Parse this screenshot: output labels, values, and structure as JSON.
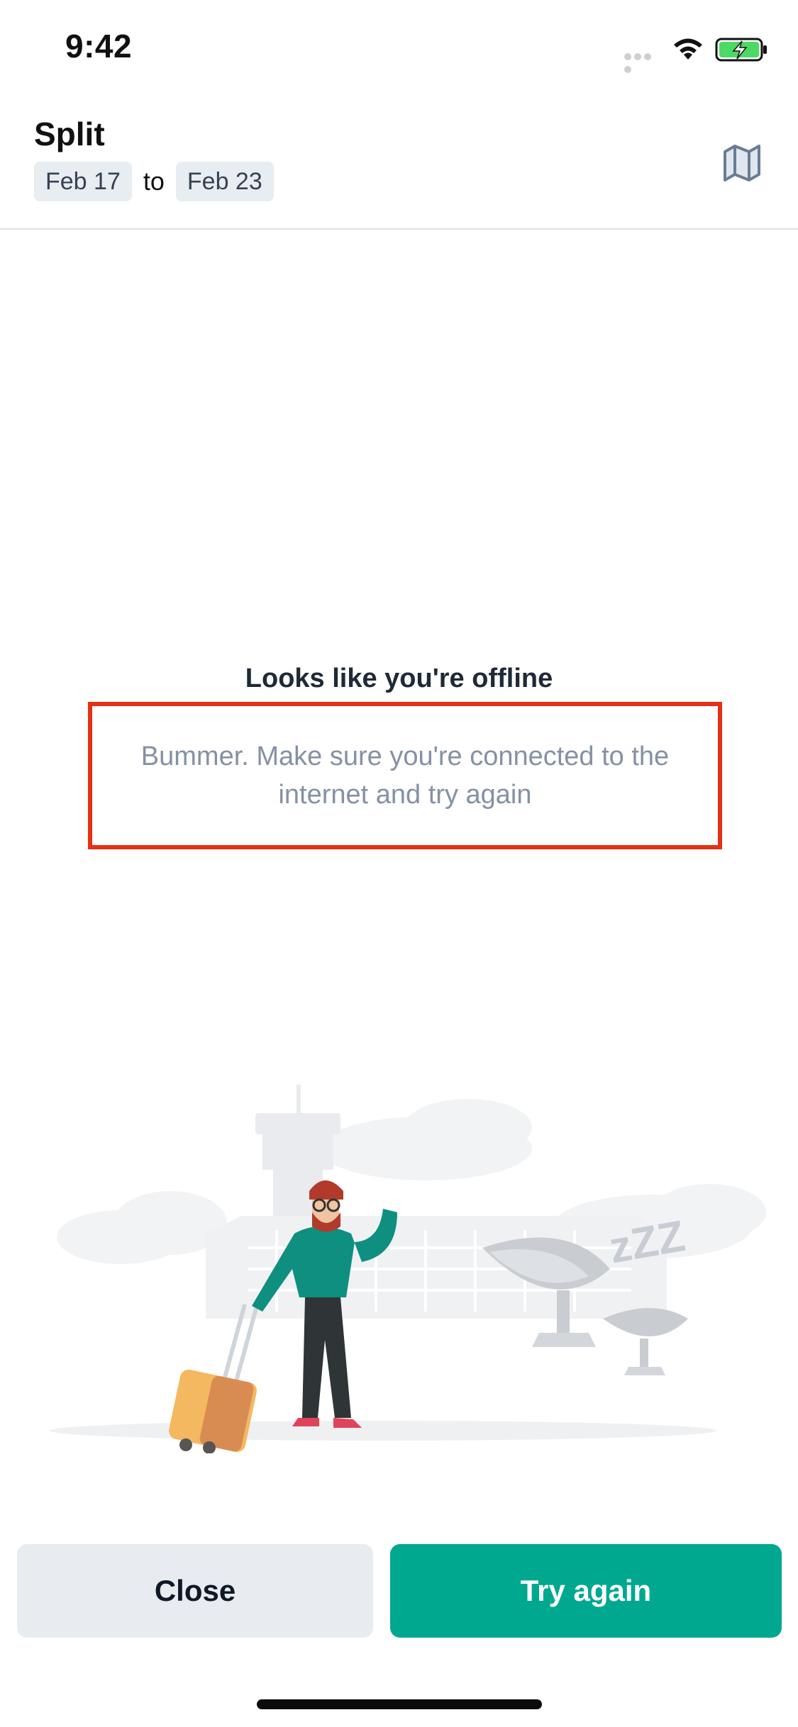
{
  "status_bar": {
    "time": "9:42"
  },
  "header": {
    "title": "Split",
    "start_date": "Feb 17",
    "separator": "to",
    "end_date": "Feb 23",
    "map_icon": "map-icon"
  },
  "message": {
    "title": "Looks like you're offline",
    "body": "Bummer. Make sure you're connected to the internet and try again",
    "highlight_color": "#e53012"
  },
  "illustration": {
    "zzz_text": "zZZ"
  },
  "actions": {
    "close_label": "Close",
    "try_again_label": "Try again",
    "accent_color": "#00a88f"
  }
}
